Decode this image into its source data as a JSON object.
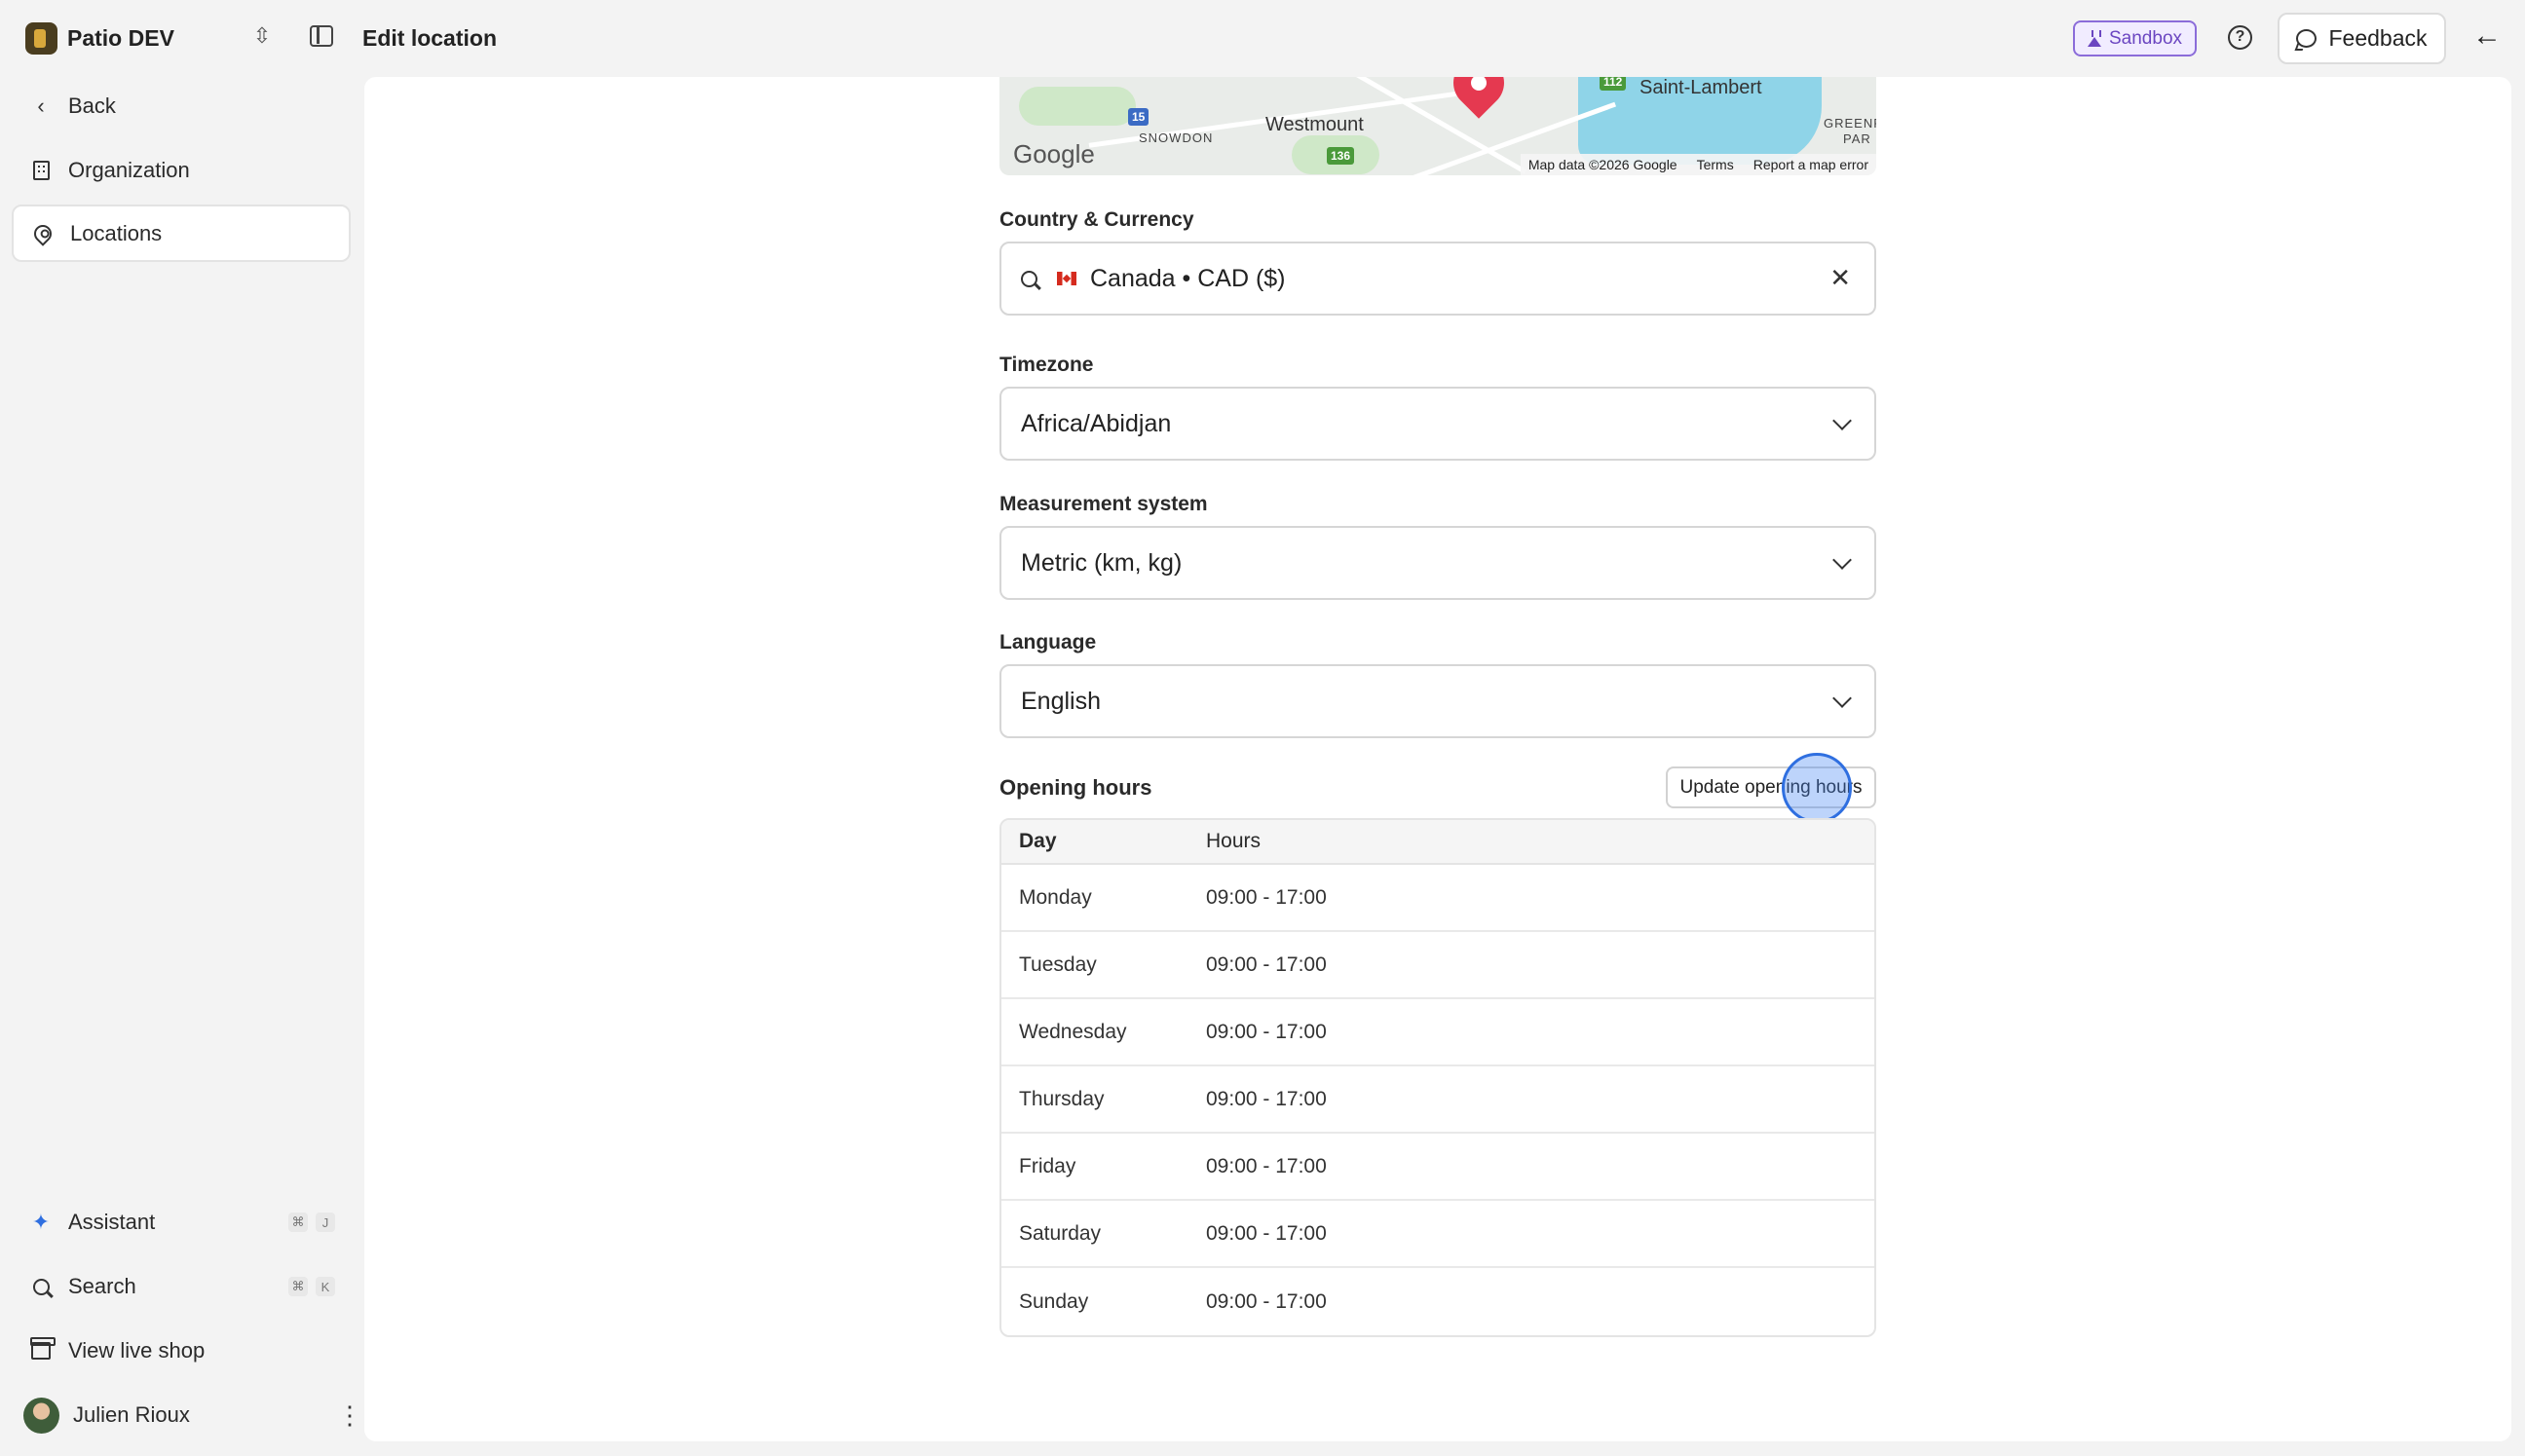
{
  "header": {
    "org_name": "Patio DEV",
    "page_title": "Edit location",
    "sandbox_label": "Sandbox",
    "feedback_label": "Feedback"
  },
  "sidebar": {
    "items": [
      {
        "label": "Back",
        "icon": "chevron-left-icon"
      },
      {
        "label": "Organization",
        "icon": "building-icon"
      },
      {
        "label": "Locations",
        "icon": "map-pin-icon",
        "active": true
      }
    ],
    "bottom": [
      {
        "label": "Assistant",
        "icon": "sparkle-icon",
        "shortcut": [
          "⌘",
          "J"
        ]
      },
      {
        "label": "Search",
        "icon": "search-icon",
        "shortcut": [
          "⌘",
          "K"
        ]
      },
      {
        "label": "View live shop",
        "icon": "store-icon"
      }
    ],
    "user": {
      "name": "Julien Rioux"
    }
  },
  "map": {
    "labels": [
      "Saint-Lambert",
      "Westmount",
      "SNOWDON",
      "GREENF",
      "PAR"
    ],
    "route_shields": [
      "15",
      "136",
      "112"
    ],
    "brand": "Google",
    "footer": [
      "Map data ©2026 Google",
      "Terms",
      "Report a map error"
    ]
  },
  "form": {
    "country_label": "Country & Currency",
    "country_value": "Canada • CAD ($)",
    "timezone_label": "Timezone",
    "timezone_value": "Africa/Abidjan",
    "measurement_label": "Measurement system",
    "measurement_value": "Metric (km, kg)",
    "language_label": "Language",
    "language_value": "English"
  },
  "opening_hours": {
    "title": "Opening hours",
    "update_button": "Update opening hours",
    "columns": [
      "Day",
      "Hours"
    ],
    "rows": [
      {
        "day": "Monday",
        "hours": "09:00 - 17:00"
      },
      {
        "day": "Tuesday",
        "hours": "09:00 - 17:00"
      },
      {
        "day": "Wednesday",
        "hours": "09:00 - 17:00"
      },
      {
        "day": "Thursday",
        "hours": "09:00 - 17:00"
      },
      {
        "day": "Friday",
        "hours": "09:00 - 17:00"
      },
      {
        "day": "Saturday",
        "hours": "09:00 - 17:00"
      },
      {
        "day": "Sunday",
        "hours": "09:00 - 17:00"
      }
    ]
  },
  "colors": {
    "accent": "#2f6fe0",
    "sandbox": "#6b46c1",
    "map_pin": "#e53950"
  }
}
